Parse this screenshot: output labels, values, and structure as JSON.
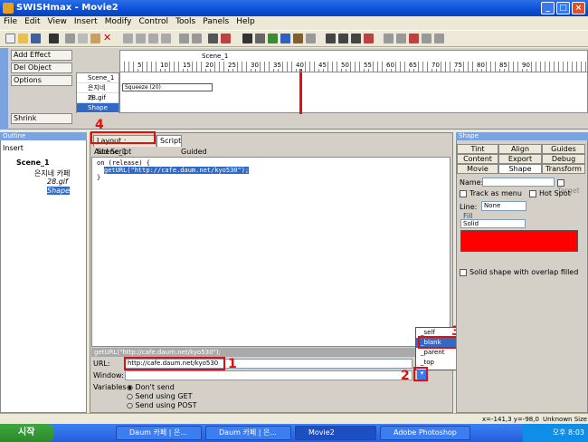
{
  "window": {
    "title": "SWISHmax - Movie2"
  },
  "menu": [
    "File",
    "Edit",
    "View",
    "Insert",
    "Modify",
    "Control",
    "Tools",
    "Panels",
    "Help"
  ],
  "timeline": {
    "buttons": [
      "Add Effect",
      "Del Object",
      "Options"
    ],
    "shrink": "Shrink",
    "rows": [
      "Scene_1",
      "은지네 카...",
      "28.gif",
      "Shape"
    ],
    "scene_label": "Scene_1",
    "squeeze": "Squeeze (20)",
    "ruler": [
      "5",
      "10",
      "15",
      "20",
      "25",
      "30",
      "35",
      "40",
      "45",
      "50",
      "55",
      "60",
      "65",
      "70",
      "75",
      "80",
      "85",
      "90"
    ]
  },
  "outline": {
    "title": "Outline",
    "insert": "Insert",
    "items": [
      "Scene_1",
      "은지네 카페",
      "28.gif",
      "Shape"
    ]
  },
  "center": {
    "tab1": "Layout : Scene_1",
    "tab2": "Script",
    "toolbar": {
      "add_script": "Add Script",
      "guided": "Guided"
    },
    "code": [
      "on (release) {",
      "getURL(\"http://cafe.daum.net/kyo530\");",
      "}"
    ],
    "status": "getURL(\"http://cafe.daum.net/kyo530\");",
    "url_label": "URL:",
    "url_value": "http://cafe.daum.net/kyo530",
    "window_label": "Window:",
    "vars_label": "Variables",
    "opt1": "Don't send",
    "opt2": "Send using GET",
    "opt3": "Send using POST"
  },
  "dropdown": [
    "_self",
    "_blank",
    "_parent",
    "_top"
  ],
  "annotations": [
    "1",
    "2",
    "3",
    "4"
  ],
  "shape": {
    "title": "Shape",
    "tabs_row1": [
      "Tint",
      "Align",
      "Guides"
    ],
    "tabs_row2": [
      "Content",
      "Export",
      "Debug"
    ],
    "tabs_row3": [
      "Movie",
      "Shape",
      "Transform"
    ],
    "name_label": "Name:",
    "target": "Target",
    "track": "Track as menu",
    "hotspot": "Hot Spot",
    "line_label": "Line:",
    "line_value": "None",
    "fill_label": "Fill",
    "fill_value": "Solid",
    "solid_overlap": "Solid shape with overlap filled",
    "fill_color": "#ff0000"
  },
  "status": {
    "coords": "x=-141,3 y=-98,0",
    "size": "Unknown Size"
  },
  "taskbar": {
    "start": "시작",
    "tasks": [
      "Daum 카페 | 은...",
      "Daum 카페 | 은...",
      "Movie2",
      "Adobe Photoshop"
    ],
    "clock": "오후 8:03"
  }
}
